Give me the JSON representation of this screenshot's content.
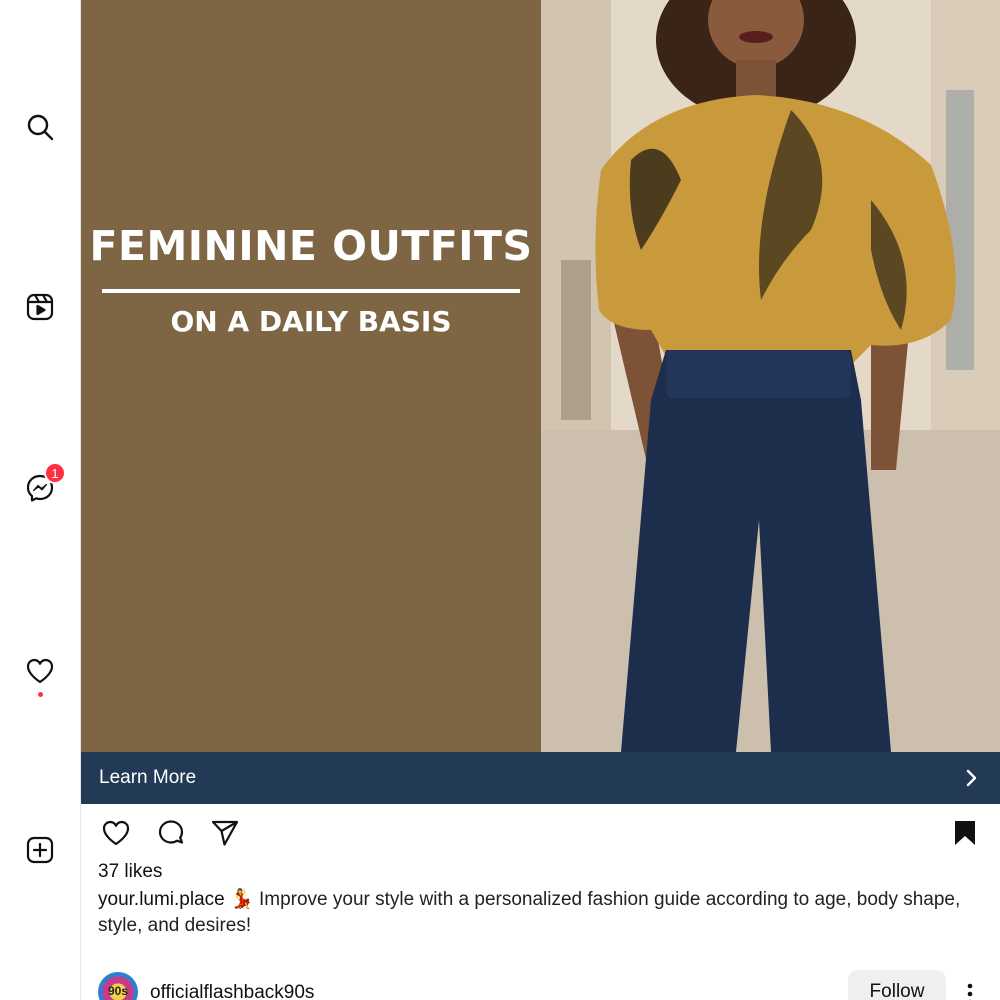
{
  "nav": {
    "items": [
      {
        "name": "search",
        "icon": "search-icon"
      },
      {
        "name": "reels",
        "icon": "reels-icon"
      },
      {
        "name": "messenger",
        "icon": "messenger-icon",
        "badge": "1"
      },
      {
        "name": "notifications",
        "icon": "heart-icon",
        "has_dot": true
      },
      {
        "name": "create",
        "icon": "plus-square-icon"
      }
    ]
  },
  "post": {
    "media": {
      "headline": "FEMININE OUTFITS",
      "subheadline": "ON A DAILY BASIS",
      "panel_color": "#7e6645"
    },
    "cta": {
      "label": "Learn More",
      "icon": "chevron-right-icon",
      "color": "#223a56"
    },
    "actions": [
      "heart-icon",
      "comment-icon",
      "share-icon",
      "bookmark-icon"
    ],
    "likes": "37 likes",
    "caption": {
      "username": "your.lumi.place",
      "emoji": "💃",
      "text": "Improve your style with a personalized fashion guide according to age, body shape, style, and desires!"
    }
  },
  "suggestion": {
    "avatar_text": "90s",
    "username": "officialflashback90s",
    "follow_label": "Follow",
    "more_icon": "more-vertical-icon"
  }
}
